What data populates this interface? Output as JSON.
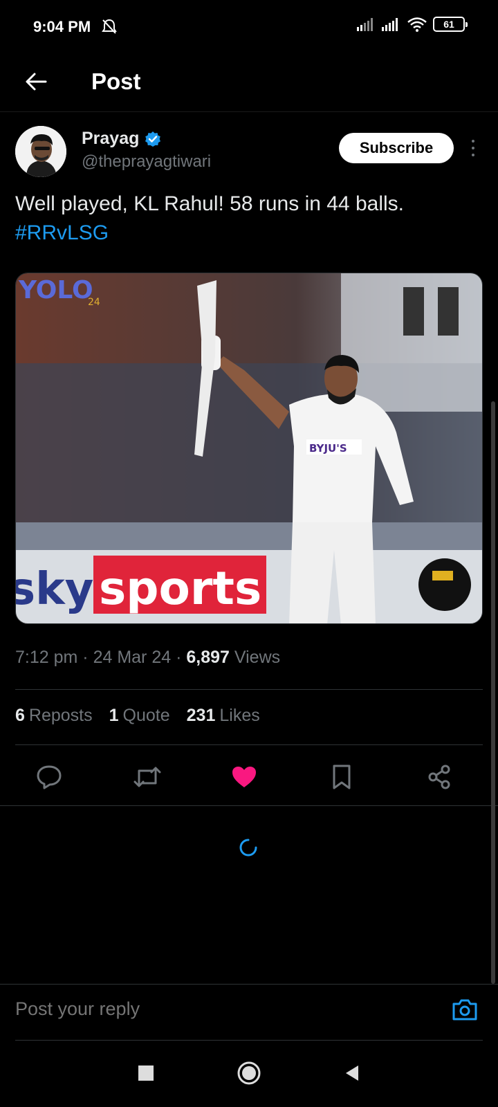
{
  "status": {
    "time": "9:04 PM",
    "battery": "61"
  },
  "header": {
    "title": "Post"
  },
  "author": {
    "name": "Prayag",
    "handle": "@theprayagtiwari",
    "subscribe_label": "Subscribe"
  },
  "post": {
    "text": "Well played, KL Rahul! 58 runs in 44 balls.",
    "hashtag": "#RRvLSG",
    "media": {
      "logo_text": "YOLO",
      "logo_sub": "24",
      "sponsor": "BYJU'S",
      "board_left": "sky",
      "board_main": "sports"
    }
  },
  "meta": {
    "time": "7:12 pm",
    "date": "24 Mar 24",
    "views_count": "6,897",
    "views_label": "Views",
    "sep": "·"
  },
  "stats": {
    "reposts_count": "6",
    "reposts_label": "Reposts",
    "quotes_count": "1",
    "quotes_label": "Quote",
    "likes_count": "231",
    "likes_label": "Likes"
  },
  "reply": {
    "placeholder": "Post your reply"
  },
  "colors": {
    "accent": "#1d9bf0",
    "like": "#f91880",
    "text_secondary": "#71767b",
    "background": "#000000"
  },
  "icons": {
    "back": "arrow-left-icon",
    "verified": "verified-badge-icon",
    "reply": "reply-icon",
    "repost": "repost-icon",
    "like": "heart-icon",
    "bookmark": "bookmark-icon",
    "share": "share-icon",
    "camera": "camera-icon",
    "spinner": "loading-spinner-icon"
  }
}
